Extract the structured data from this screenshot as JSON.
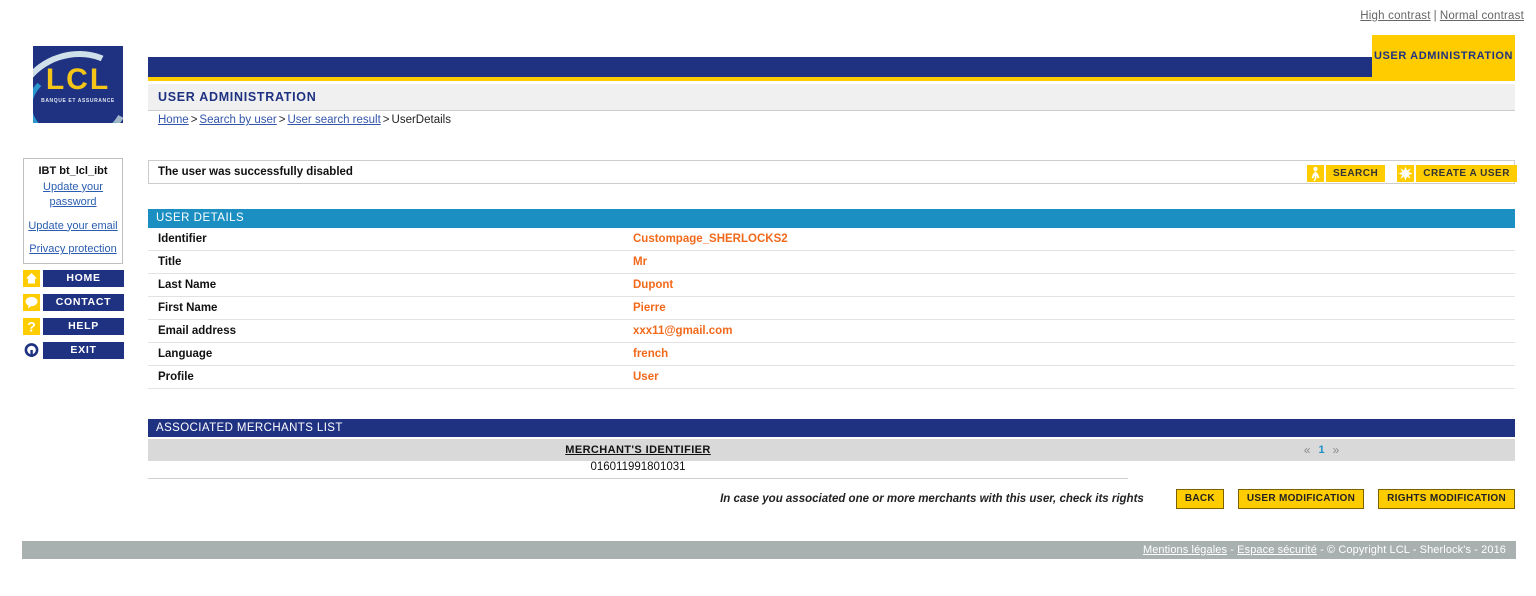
{
  "topbar": {
    "high_contrast": "High contrast",
    "separator": "|",
    "normal_contrast": "Normal contrast"
  },
  "logo": {
    "name": "LCL",
    "tagline": "BANQUE ET ASSURANCE"
  },
  "header": {
    "tab_label": "USER ADMINISTRATION",
    "section_title": "USER ADMINISTRATION"
  },
  "breadcrumb": {
    "items": [
      {
        "label": "Home",
        "link": true
      },
      {
        "label": "Search by user",
        "link": true
      },
      {
        "label": "User search result",
        "link": true
      },
      {
        "label": "UserDetails",
        "link": false
      }
    ],
    "separator": ">"
  },
  "user_panel": {
    "username": "IBT bt_lcl_ibt",
    "update_password": "Update your password",
    "update_email": "Update your email",
    "privacy": "Privacy protection"
  },
  "nav": {
    "items": [
      {
        "label": "HOME",
        "icon": "home-icon"
      },
      {
        "label": "CONTACT",
        "icon": "speech-bubble-icon"
      },
      {
        "label": "HELP",
        "icon": "question-mark-icon"
      },
      {
        "label": "EXIT",
        "icon": "exit-icon"
      }
    ]
  },
  "message": {
    "text": "The user was successfully disabled"
  },
  "actions": {
    "search_label": "SEARCH",
    "search_icon": "person-icon",
    "create_label": "CREATE A USER",
    "create_icon": "starburst-icon"
  },
  "user_details": {
    "panel_title": "USER DETAILS",
    "rows": [
      {
        "label": "Identifier",
        "value": "Custompage_SHERLOCKS2"
      },
      {
        "label": "Title",
        "value": "Mr"
      },
      {
        "label": "Last Name",
        "value": "Dupont"
      },
      {
        "label": "First Name",
        "value": "Pierre"
      },
      {
        "label": "Email address",
        "value": "xxx11@gmail.com"
      },
      {
        "label": "Language",
        "value": "french"
      },
      {
        "label": "Profile",
        "value": "User"
      }
    ]
  },
  "merchants": {
    "panel_title": "ASSOCIATED MERCHANTS LIST",
    "column_header": "MERCHANT'S IDENTIFIER",
    "rows": [
      "016011991801031"
    ],
    "pager": {
      "prev": "«",
      "page": "1",
      "next": "»"
    }
  },
  "bottom": {
    "hint": "In case you associated one or more merchants with this user, check its rights",
    "back_label": "BACK",
    "user_modification_label": "USER MODIFICATION",
    "rights_modification_label": "RIGHTS MODIFICATION"
  },
  "footer": {
    "legal": "Mentions légales",
    "security": "Espace sécurité",
    "copyright": "© Copyright LCL - Sherlock's - 2016",
    "dash": "-"
  },
  "colors": {
    "navy": "#1f3282",
    "yellow": "#ffcc00",
    "teal": "#1b8ec2",
    "orange": "#f2691b",
    "footer_gray": "#a8b0b0"
  }
}
